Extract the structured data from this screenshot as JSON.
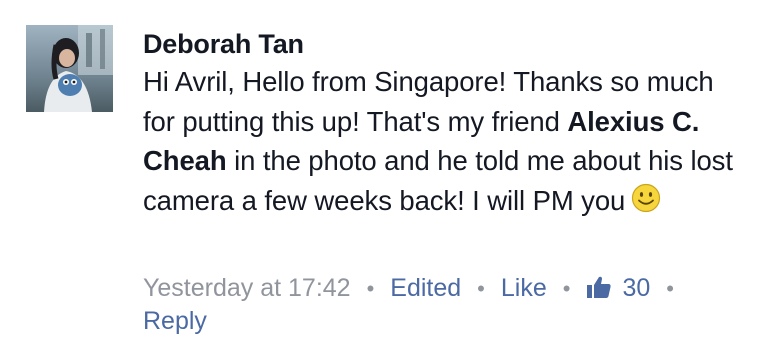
{
  "comment": {
    "author": "Deborah Tan",
    "body_part1": "Hi Avril, Hello from Singapore! Thanks so much for putting this up! That's my friend ",
    "mention": "Alexius C. Cheah",
    "body_part2": " in the photo and he told me about his lost camera a few weeks back! I will PM you",
    "emoji_icon": "smiley-icon",
    "timestamp": "Yesterday at 17:42",
    "separator": "•",
    "edited_label": "Edited",
    "like_label": "Like",
    "like_icon": "thumbs-up-icon",
    "like_count": "30",
    "reply_label": "Reply"
  },
  "colors": {
    "text": "#141823",
    "meta_gray": "#90949c",
    "link_blue": "#4b6aa3",
    "emoji_yellow": "#f7d53c"
  }
}
